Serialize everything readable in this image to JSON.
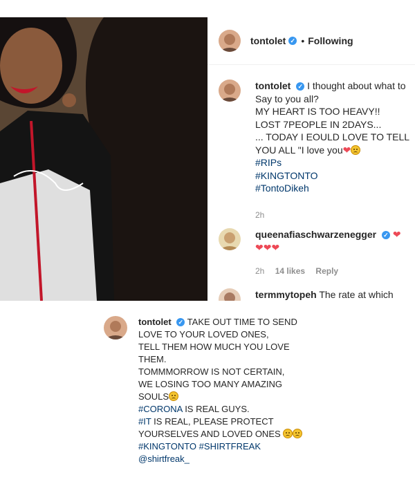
{
  "post": {
    "username": "tontolet",
    "following_label": "Following",
    "caption_lines": [
      "I thought about what to Say to you all?",
      "MY HEART IS TOO HEAVY!!",
      "LOST 7PEOPLE IN 2DAYS...",
      "... TODAY I EOULD LOVE TO TELL YOU ALL \"I love you"
    ],
    "hashtags": [
      "#RIPs",
      "#KINGTONTO",
      "#TontoDikeh"
    ],
    "time": "2h"
  },
  "comments": [
    {
      "username": "queenafiaschwarzenegger",
      "time": "2h",
      "likes": "14 likes",
      "reply_label": "Reply"
    },
    {
      "username": "termmytopeh",
      "text": "The rate at which"
    }
  ],
  "bottom_post": {
    "username": "tontolet",
    "lines": [
      "TAKE OUT TIME TO SEND LOVE TO YOUR LOVED ONES,",
      "TELL THEM HOW MUCH YOU LOVE THEM.",
      "TOMMMORROW IS NOT CERTAIN,",
      "WE LOSING TOO MANY AMAZING SOULS"
    ],
    "tag_corona": "#CORONA",
    "corona_rest": " IS REAL GUYS.",
    "tag_it": "#IT",
    "it_rest": " IS REAL, PLEASE PROTECT YOURSELVES AND LOVED ONES",
    "tag_king": "#KINGTONTO",
    "tag_shirt": "#SHIRTFREAK",
    "mention": "@shirtfreak_"
  },
  "colors": {
    "accent": "#3897f0",
    "heart": "#ed4956",
    "link": "#00376b"
  },
  "icons": [
    "verified-badge-icon",
    "heart-icon",
    "sad-emoji-icon"
  ]
}
